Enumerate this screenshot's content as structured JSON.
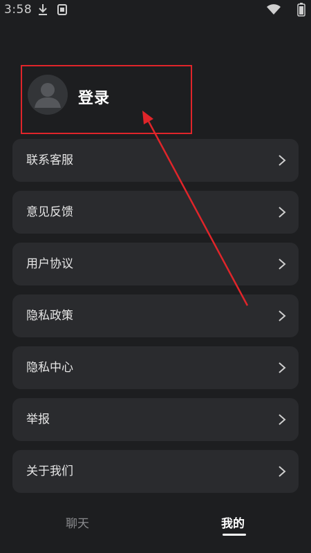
{
  "status_bar": {
    "time": "3:58",
    "icons": [
      "download-icon",
      "app-notification-icon",
      "wifi-icon",
      "battery-icon"
    ]
  },
  "profile": {
    "avatar_icon": "default-avatar-icon",
    "login_label": "登录"
  },
  "annotation": {
    "box_color": "#e0252a",
    "arrow_color": "#e0252a"
  },
  "menu": {
    "items": [
      {
        "label": "联系客服",
        "icon": "chevron-right-icon"
      },
      {
        "label": "意见反馈",
        "icon": "chevron-right-icon"
      },
      {
        "label": "用户协议",
        "icon": "chevron-right-icon"
      },
      {
        "label": "隐私政策",
        "icon": "chevron-right-icon"
      },
      {
        "label": "隐私中心",
        "icon": "chevron-right-icon"
      },
      {
        "label": "举报",
        "icon": "chevron-right-icon"
      },
      {
        "label": "关于我们",
        "icon": "chevron-right-icon"
      }
    ]
  },
  "bottom_nav": {
    "tabs": [
      {
        "label": "聊天",
        "active": false
      },
      {
        "label": "我的",
        "active": true
      }
    ]
  },
  "colors": {
    "background": "#1d1e20",
    "card": "#2a2b2e",
    "text": "#e6e6e6",
    "muted": "#8a8b8e",
    "accent": "#ffffff"
  }
}
